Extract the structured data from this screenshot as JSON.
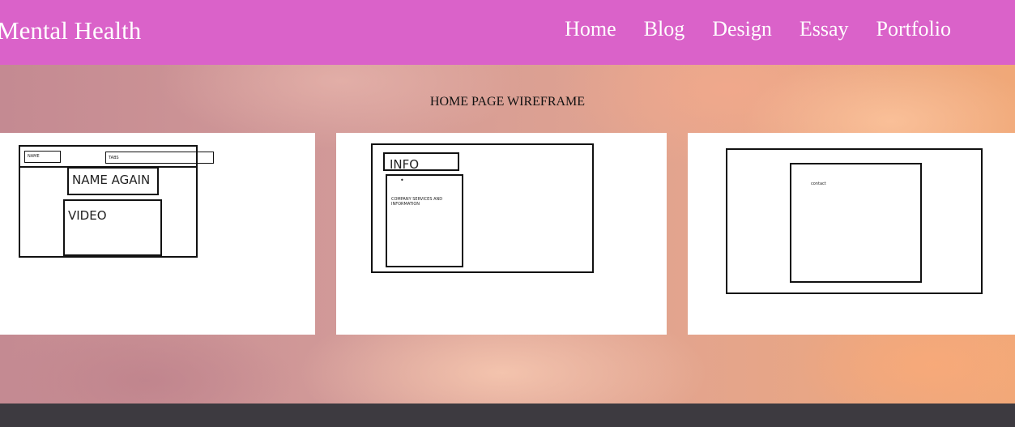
{
  "header": {
    "brand": "Mental Health",
    "nav": [
      "Home",
      "Blog",
      "Design",
      "Essay",
      "Portfolio"
    ]
  },
  "main": {
    "title": "HOME PAGE WIREFRAME",
    "wireframes": {
      "home": {
        "name": "NAME",
        "tabs": "TABS",
        "name_again": "NAME AGAIN",
        "video": "VIDEO"
      },
      "info": {
        "heading": "INFO",
        "bullet": "•",
        "text": "COMPANY SERVICES AND INFORMATION"
      },
      "contact": {
        "text": "contact"
      }
    }
  },
  "colors": {
    "header_bg": "#da62c9",
    "footer_bg": "#3d3a40"
  }
}
